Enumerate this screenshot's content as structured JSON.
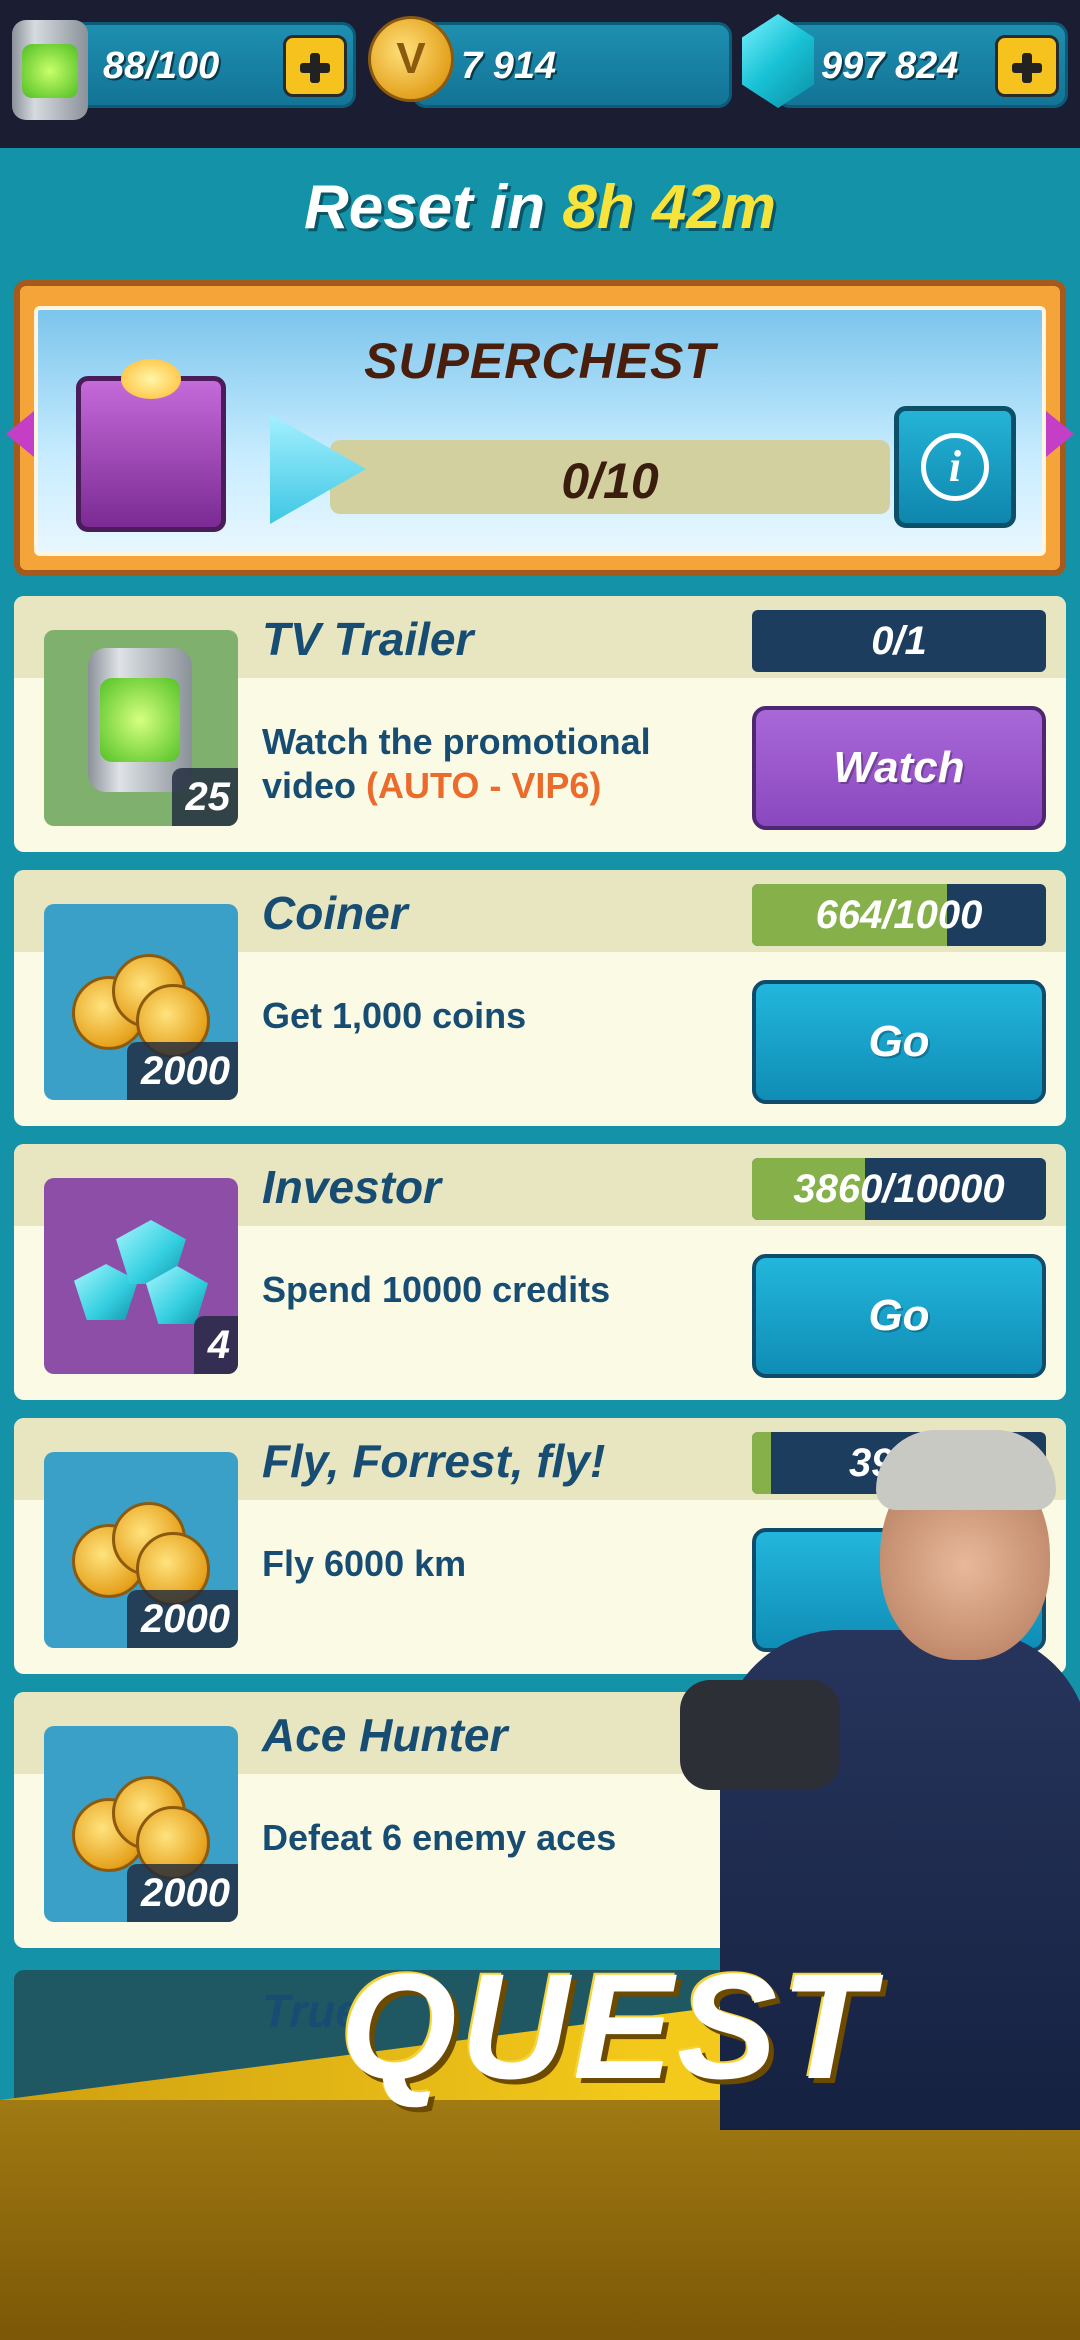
{
  "resources": {
    "fuel": "88/100",
    "coins": "7 914",
    "gems": "997 824"
  },
  "reset": {
    "label": "Reset in",
    "time": "8h 42m"
  },
  "superchest": {
    "title": "SUPERCHEST",
    "progress": "0/10",
    "info_symbol": "i"
  },
  "quests": [
    {
      "title": "TV Trailer",
      "desc": "Watch the promotional video",
      "desc_vip": "(AUTO - VIP6)",
      "progress_text": "0/1",
      "progress_fraction": 0,
      "button": "Watch",
      "reward_badge": "25",
      "icon": "fuel-can-icon"
    },
    {
      "title": "Coiner",
      "desc": "Get 1,000 coins",
      "progress_text": "664/1000",
      "progress_fraction": 0.664,
      "button": "Go",
      "reward_badge": "2000",
      "icon": "coins-icon"
    },
    {
      "title": "Investor",
      "desc": "Spend 10000 credits",
      "progress_text": "3860/10000",
      "progress_fraction": 0.386,
      "button": "Go",
      "reward_badge": "4",
      "icon": "gems-icon"
    },
    {
      "title": "Fly, Forrest, fly!",
      "desc": "Fly 6000 km",
      "progress_text": "397/6",
      "progress_fraction": 0.066,
      "button": "G",
      "reward_badge": "2000",
      "icon": "coins-icon"
    },
    {
      "title": "Ace Hunter",
      "desc": "Defeat 6 enemy aces",
      "reward_badge": "2000",
      "icon": "coins-icon"
    },
    {
      "title": "True"
    }
  ],
  "banner": {
    "text": "QUEST"
  },
  "colors": {
    "accent_yellow": "#f8e33a",
    "go_blue": "#23b6dc",
    "watch_purple": "#a968d8",
    "progress_green": "#86b04a"
  }
}
